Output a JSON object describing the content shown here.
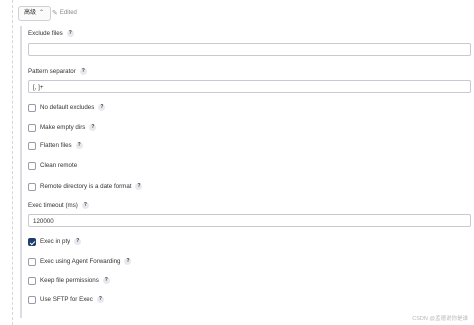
{
  "header": {
    "advanced_label": "高级",
    "chevron": "chevron-up-icon",
    "edited_label": "Edited",
    "edited_icon": "pencil-icon"
  },
  "fields": {
    "exclude_files": {
      "label": "Exclude files",
      "value": ""
    },
    "pattern_separator": {
      "label": "Pattern separator",
      "value": "[, ]+"
    },
    "exec_timeout": {
      "label": "Exec timeout (ms)",
      "value": "120000"
    }
  },
  "checkboxes": {
    "no_default_excludes": {
      "label": "No default excludes",
      "checked": false
    },
    "make_empty_dirs": {
      "label": "Make empty dirs",
      "checked": false
    },
    "flatten_files": {
      "label": "Flatten files",
      "checked": false
    },
    "clean_remote": {
      "label": "Clean remote",
      "checked": false
    },
    "remote_dir_date": {
      "label": "Remote directory is a date format",
      "checked": false
    },
    "exec_in_pty": {
      "label": "Exec in pty",
      "checked": true
    },
    "exec_agent_forwarding": {
      "label": "Exec using Agent Forwarding",
      "checked": false
    },
    "keep_file_permissions": {
      "label": "Keep file permissions",
      "checked": false
    },
    "use_sftp_for_exec": {
      "label": "Use SFTP for Exec",
      "checked": false
    }
  },
  "help_symbol": "?",
  "watermark": "CSDN @孟德说你是谁",
  "colors": {
    "checked": "#1d3d6e",
    "border": "#c9c9d2"
  }
}
